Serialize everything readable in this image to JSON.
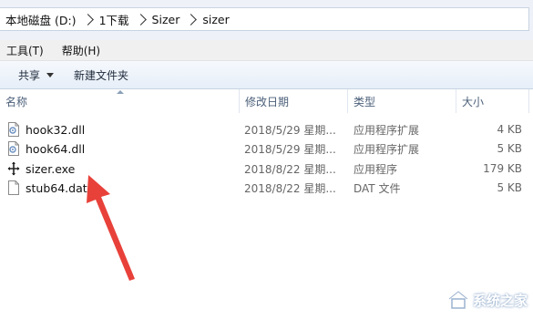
{
  "address": {
    "crumbs": [
      "本地磁盘 (D:)",
      "1下载",
      "Sizer",
      "sizer"
    ]
  },
  "menu": [
    "工具(T)",
    "帮助(H)"
  ],
  "toolbar": {
    "share": "共享",
    "new_folder": "新建文件夹"
  },
  "columns": {
    "name": "名称",
    "modified": "修改日期",
    "type": "类型",
    "size": "大小"
  },
  "files": [
    {
      "name": "hook32.dll",
      "modified": "2018/5/29 星期...",
      "type": "应用程序扩展",
      "size": "4 KB",
      "icon": "dll-file-icon"
    },
    {
      "name": "hook64.dll",
      "modified": "2018/5/29 星期...",
      "type": "应用程序扩展",
      "size": "5 KB",
      "icon": "dll-file-icon"
    },
    {
      "name": "sizer.exe",
      "modified": "2018/8/22 星期...",
      "type": "应用程序",
      "size": "179 KB",
      "icon": "move-arrows-icon"
    },
    {
      "name": "stub64.dat",
      "modified": "2018/8/22 星期...",
      "type": "DAT 文件",
      "size": "5 KB",
      "icon": "blank-file-icon"
    }
  ],
  "watermark": "系统之家",
  "colors": {
    "accent_arrow": "#e8413a",
    "header_text": "#4c607a",
    "toolbar_bg": "#e6eef8"
  }
}
